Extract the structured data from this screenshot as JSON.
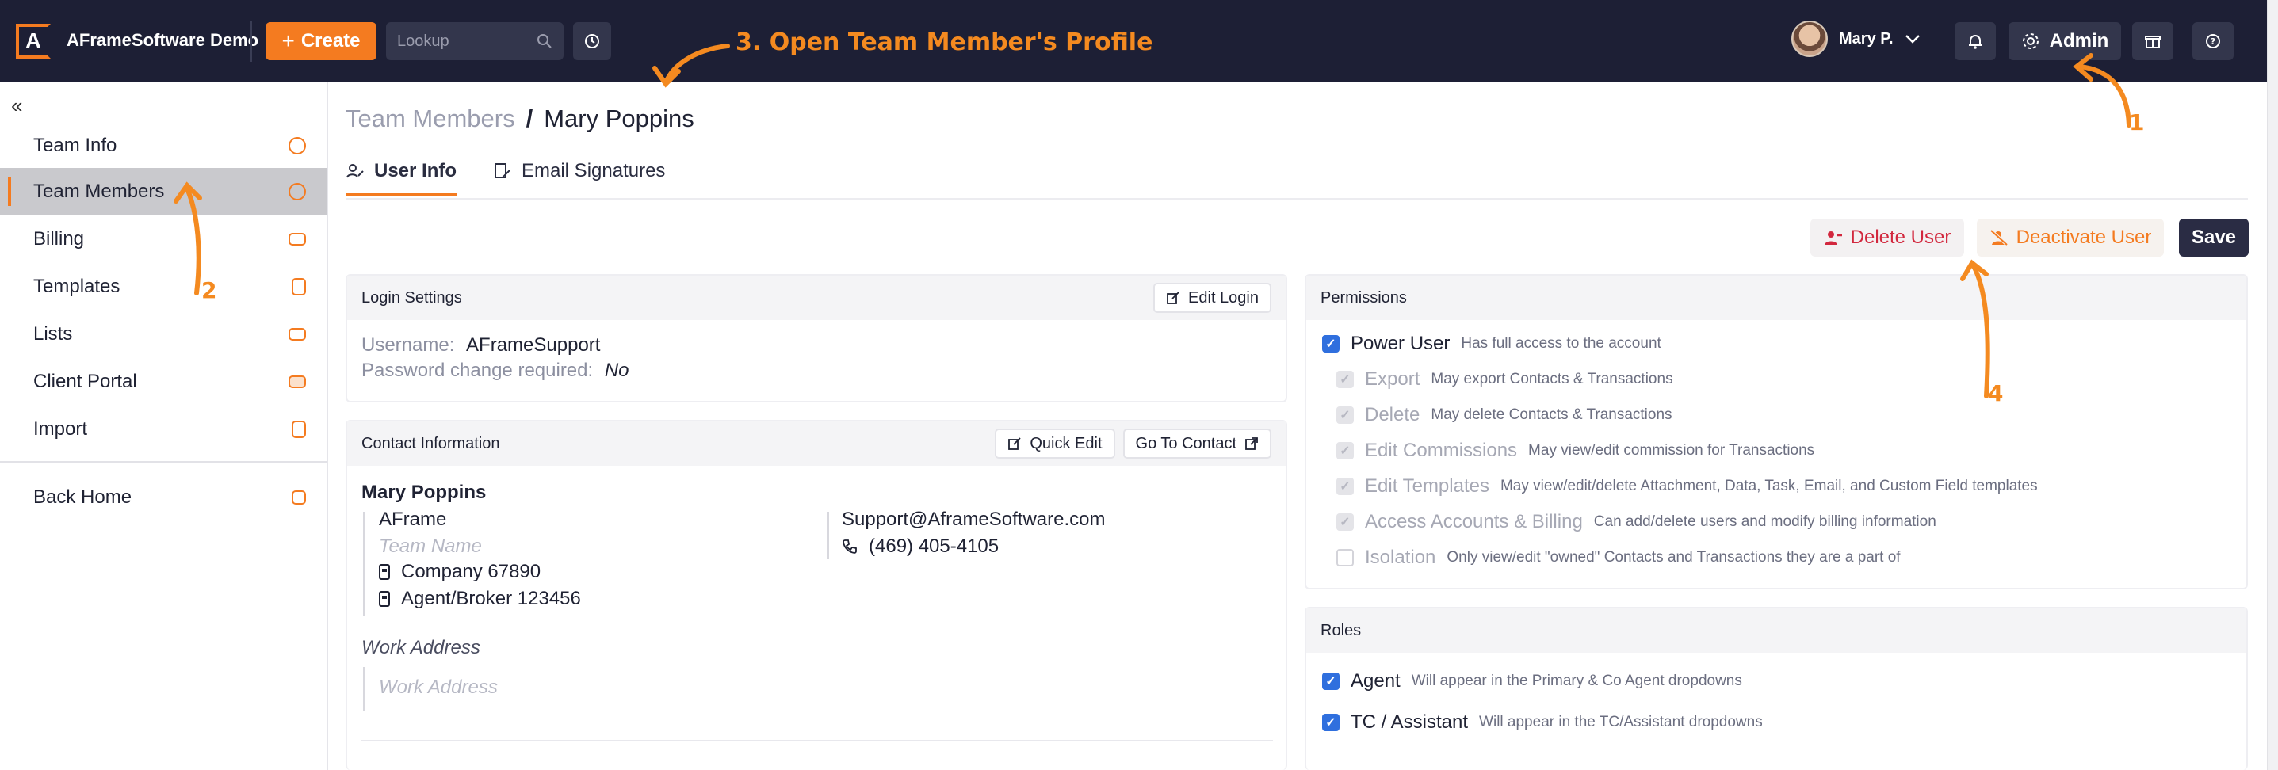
{
  "app": {
    "logo_letter": "A",
    "title": "AFrameSoftware Demo"
  },
  "topbar": {
    "create_label": "Create",
    "lookup_placeholder": "Lookup",
    "user_name": "Mary P.",
    "admin_label": "Admin"
  },
  "annotations": {
    "step3": "3. Open Team Member's Profile",
    "step1": "1",
    "step2": "2",
    "step4": "4"
  },
  "sidebar": {
    "items": [
      {
        "label": "Team Info"
      },
      {
        "label": "Team Members"
      },
      {
        "label": "Billing"
      },
      {
        "label": "Templates"
      },
      {
        "label": "Lists"
      },
      {
        "label": "Client Portal"
      },
      {
        "label": "Import"
      }
    ],
    "back_home": "Back Home"
  },
  "breadcrumb": {
    "parent": "Team Members",
    "separator": "/",
    "current": "Mary Poppins"
  },
  "tabs": [
    {
      "label": "User Info"
    },
    {
      "label": "Email Signatures"
    }
  ],
  "actions": {
    "delete": "Delete User",
    "deactivate": "Deactivate User",
    "save": "Save"
  },
  "login": {
    "header": "Login Settings",
    "edit_button": "Edit Login",
    "username_label": "Username:",
    "username_value": "AFrameSupport",
    "pw_label": "Password change required:",
    "pw_value": "No"
  },
  "contact": {
    "header": "Contact Information",
    "quick_edit": "Quick Edit",
    "go_to_contact": "Go To Contact",
    "name": "Mary Poppins",
    "company": "AFrame",
    "team_name_placeholder": "Team Name",
    "company_id": "Company 67890",
    "agent_id": "Agent/Broker  123456",
    "email": "Support@AframeSoftware.com",
    "phone": "(469) 405-4105",
    "work_address_label": "Work Address",
    "work_address_placeholder": "Work Address"
  },
  "permissions": {
    "header": "Permissions",
    "items": [
      {
        "label": "Power User",
        "desc": "Has full access to the account"
      },
      {
        "label": "Export",
        "desc": "May export Contacts & Transactions"
      },
      {
        "label": "Delete",
        "desc": "May delete Contacts & Transactions"
      },
      {
        "label": "Edit Commissions",
        "desc": "May view/edit commission for Transactions"
      },
      {
        "label": "Edit Templates",
        "desc": "May view/edit/delete Attachment, Data, Task, Email, and Custom Field templates"
      },
      {
        "label": "Access Accounts & Billing",
        "desc": "Can add/delete users and modify billing information"
      },
      {
        "label": "Isolation",
        "desc": "Only view/edit \"owned\" Contacts and Transactions they are a part of"
      }
    ]
  },
  "roles": {
    "header": "Roles",
    "items": [
      {
        "label": "Agent",
        "desc": "Will appear in the Primary & Co Agent dropdowns"
      },
      {
        "label": "TC / Assistant",
        "desc": "Will appear in the TC/Assistant dropdowns"
      }
    ]
  },
  "colors": {
    "brand": "#f47b20",
    "nav": "#1d1f35",
    "danger": "#d2283e",
    "checkbox": "#2f6fde"
  }
}
